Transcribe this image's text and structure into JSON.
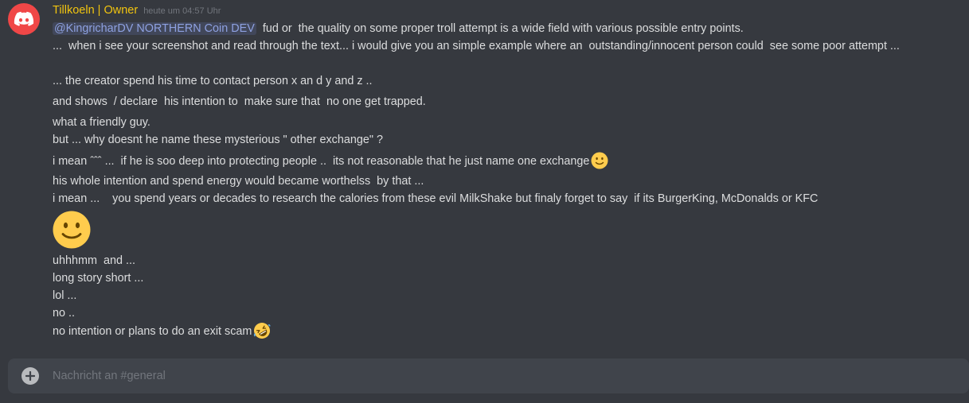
{
  "message": {
    "author": "Tillkoeln | Owner",
    "timestamp": "heute um 04:57 Uhr",
    "mention": "@KingricharDV NORTHERN Coin DEV",
    "lines": [
      "  fud or  the quality on some proper troll attempt is a wide field with various possible entry points.",
      "...  when i see your screenshot and read through the text... i would give you an simple example where an  outstanding/innocent person could  see some poor attempt ...",
      "... the creator spend his time to contact person x an d y and z ..",
      "and shows  / declare  his intention to  make sure that  no one get trapped.",
      "what a friendly guy.",
      "but ... why doesnt he name these mysterious \" other exchange\" ?",
      "i mean ˆˆˆ ...  if he is soo deep into protecting people ..  its not reasonable that he just name one exchange",
      "his whole intention and spend energy would became worthelss  by that ...",
      "i mean ...    you spend years or decades to research the calories from these evil MilkShake but finaly forget to say  if its BurgerKing, McDonalds or KFC",
      "uhhhmm  and ...",
      "long story short ...",
      "lol ...",
      "no ..",
      "no intention or plans to do an exit scam"
    ],
    "emojis": {
      "inline_smile": "slightly-smiling-face-icon",
      "big_smile": "slightly-smiling-face-icon",
      "rofl": "rolling-on-floor-laughing-icon"
    }
  },
  "composer": {
    "placeholder": "Nachricht an #general"
  },
  "colors": {
    "background": "#36393f",
    "author": "#f1c40f",
    "avatar": "#f04747",
    "mention": "#8ea1e1"
  }
}
